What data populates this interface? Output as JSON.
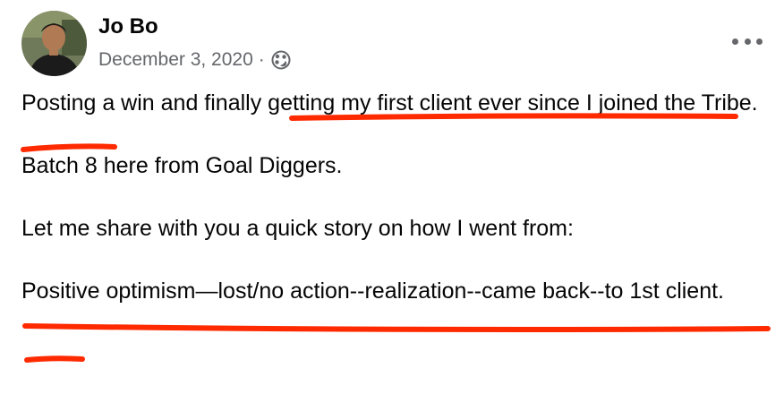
{
  "post": {
    "author": "Jo Bo",
    "date": "December 3, 2020",
    "separator": "·",
    "audience_icon": "globe-icon",
    "menu_icon": "more-horizontal-icon",
    "paragraphs": [
      "Posting a win and finally getting my first client ever since I joined the Tribe.",
      "Batch 8 here from Goal Diggers.",
      "Let me share with you a quick story on how I went from:",
      "Positive optimism—lost/no action--realization--came back--to 1st client."
    ]
  },
  "colors": {
    "annotation": "#ff2a00",
    "meta_text": "#65676b",
    "body_text": "#050505"
  }
}
